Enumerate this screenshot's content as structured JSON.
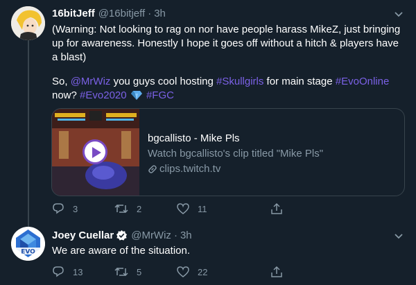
{
  "tweets": [
    {
      "name": "16bitJeff",
      "handle": "@16bitjeff",
      "separator": "·",
      "time": "3h",
      "text_line1": "(Warning: Not looking to rag on nor have people harass MikeZ, just bringing up for awareness. Honestly I hope it goes off without a hitch & players have a blast)",
      "text2_prefix": "So, ",
      "mention": "@MrWiz",
      "text2_mid": " you guys cool hosting ",
      "hashtag1": "#Skullgirls",
      "text2_mid2": " for main stage ",
      "hashtag2": "#EvoOnline",
      "text2_mid3": " now? ",
      "hashtag3": "#Evo2020",
      "hashtag4": "#FGC",
      "card": {
        "title": "bgcallisto - Mike Pls",
        "description": "Watch bgcallisto's clip titled \"Mike Pls\"",
        "domain": "clips.twitch.tv"
      },
      "actions": {
        "replies": "3",
        "retweets": "2",
        "likes": "11"
      }
    },
    {
      "name": "Joey Cuellar",
      "handle": "@MrWiz",
      "separator": "·",
      "time": "3h",
      "text": "We are aware of the situation.",
      "actions": {
        "replies": "13",
        "retweets": "5",
        "likes": "22"
      }
    }
  ],
  "colors": {
    "background": "#15202b",
    "link": "#7b61e6",
    "muted": "#8899a6",
    "verified": "#1da1f2"
  },
  "icons": [
    "reply-icon",
    "retweet-icon",
    "like-icon",
    "share-icon",
    "caret-icon",
    "verified-icon",
    "link-icon",
    "play-icon",
    "gem-emoji"
  ]
}
